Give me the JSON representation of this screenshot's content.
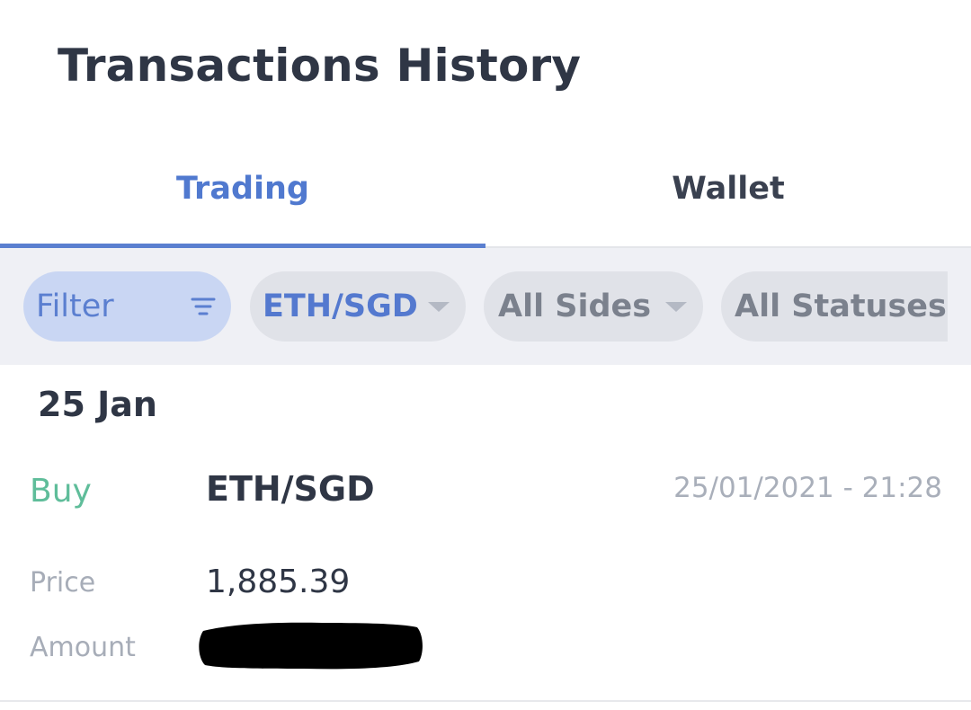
{
  "header": {
    "title": "Transactions History"
  },
  "tabs": [
    {
      "label": "Trading",
      "active": true
    },
    {
      "label": "Wallet",
      "active": false
    }
  ],
  "filters": {
    "filter_label": "Filter",
    "pair_selected": "ETH/SGD",
    "side_selected": "All Sides",
    "status_selected": "All Statuses"
  },
  "transactions": {
    "date_group": "25 Jan",
    "items": [
      {
        "side": "Buy",
        "pair": "ETH/SGD",
        "timestamp": "25/01/2021 - 21:28",
        "price_label": "Price",
        "price": "1,885.39",
        "amount_label": "Amount"
      }
    ]
  },
  "icons": {
    "filter": "filter-lines-icon",
    "dropdown": "caret-down-icon"
  },
  "colors": {
    "accent": "#5a7fd0",
    "buy": "#5fbd9a",
    "text": "#2f3645",
    "muted": "#a9afba"
  }
}
